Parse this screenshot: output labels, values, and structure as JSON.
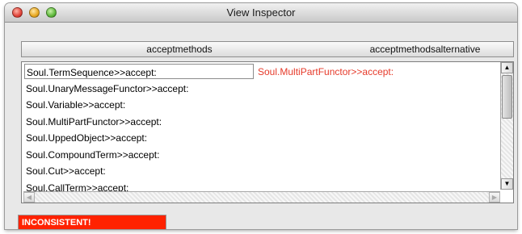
{
  "window": {
    "title": "View Inspector"
  },
  "table": {
    "columns": [
      "acceptmethods",
      "acceptmethodsalternative"
    ],
    "rows": [
      {
        "accept": "Soul.TermSequence>>accept:",
        "alternative": "Soul.MultiPartFunctor>>accept:",
        "selected": true
      },
      {
        "accept": "Soul.UnaryMessageFunctor>>accept:",
        "alternative": ""
      },
      {
        "accept": "Soul.Variable>>accept:",
        "alternative": ""
      },
      {
        "accept": "Soul.MultiPartFunctor>>accept:",
        "alternative": ""
      },
      {
        "accept": "Soul.UppedObject>>accept:",
        "alternative": ""
      },
      {
        "accept": "Soul.CompoundTerm>>accept:",
        "alternative": ""
      },
      {
        "accept": "Soul.Cut>>accept:",
        "alternative": ""
      },
      {
        "accept": "Soul.CallTerm>>accept:",
        "alternative": ""
      }
    ]
  },
  "status": {
    "text": "INCONSISTENT!",
    "color": "#ff2200"
  },
  "colors": {
    "alternative_text": "#e63a2a",
    "window_bg": "#e8e8e8"
  },
  "icons": {
    "close": "close-icon",
    "minimize": "minimize-icon",
    "zoom": "zoom-icon",
    "scroll_up": "up-arrow-icon",
    "scroll_down": "down-arrow-icon",
    "scroll_left": "left-arrow-icon",
    "scroll_right": "right-arrow-icon"
  }
}
